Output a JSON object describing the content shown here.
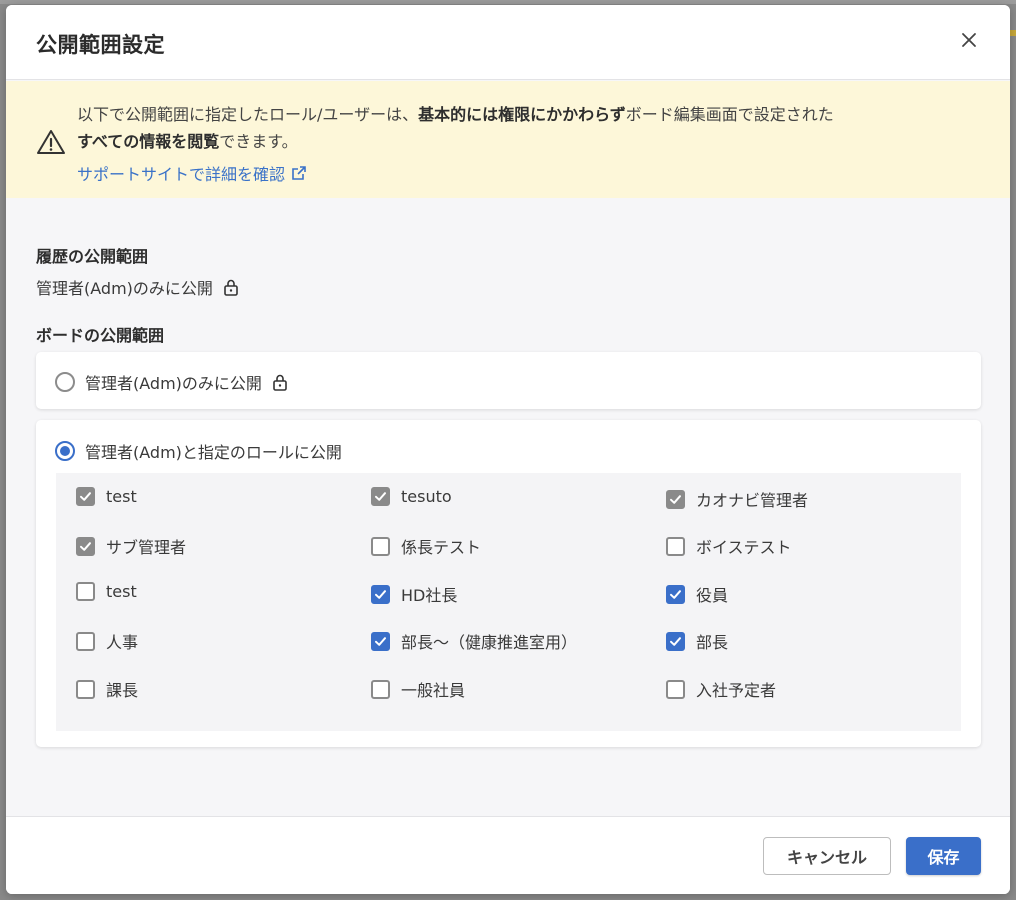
{
  "dialog": {
    "title": "公開範囲設定"
  },
  "alert": {
    "line1_pre": "以下で公開範囲に指定したロール/ユーザーは、",
    "line1_bold": "基本的には権限にかかわらず",
    "line1_post": "ボード編集画面で設定された",
    "line2_bold": "すべての情報を閲覧",
    "line2_post": "できます。",
    "link_label": "サポートサイトで詳細を確認"
  },
  "history": {
    "title": "履歴の公開範囲",
    "value": "管理者(Adm)のみに公開"
  },
  "board": {
    "title": "ボードの公開範囲",
    "option_admin_only": "管理者(Adm)のみに公開",
    "option_admin_roles": "管理者(Adm)と指定のロールに公開",
    "selected_option": "option_admin_roles",
    "roles": [
      {
        "label": "test",
        "state": "checked-disabled"
      },
      {
        "label": "tesuto",
        "state": "checked-disabled"
      },
      {
        "label": "カオナビ管理者",
        "state": "checked-disabled"
      },
      {
        "label": "サブ管理者",
        "state": "checked-disabled"
      },
      {
        "label": "係長テスト",
        "state": "unchecked"
      },
      {
        "label": "ボイステスト",
        "state": "unchecked"
      },
      {
        "label": "test",
        "state": "unchecked"
      },
      {
        "label": "HD社長",
        "state": "checked"
      },
      {
        "label": "役員",
        "state": "checked"
      },
      {
        "label": "人事",
        "state": "unchecked"
      },
      {
        "label": "部長〜（健康推進室用）",
        "state": "checked"
      },
      {
        "label": "部長",
        "state": "checked"
      },
      {
        "label": "課長",
        "state": "unchecked"
      },
      {
        "label": "一般社員",
        "state": "unchecked"
      },
      {
        "label": "入社予定者",
        "state": "unchecked"
      }
    ]
  },
  "footer": {
    "cancel_label": "キャンセル",
    "save_label": "保存"
  },
  "colors": {
    "accent": "#3a6fc9",
    "alert_bg": "#fdf7d9",
    "disabled_check": "#8a8a8a"
  }
}
